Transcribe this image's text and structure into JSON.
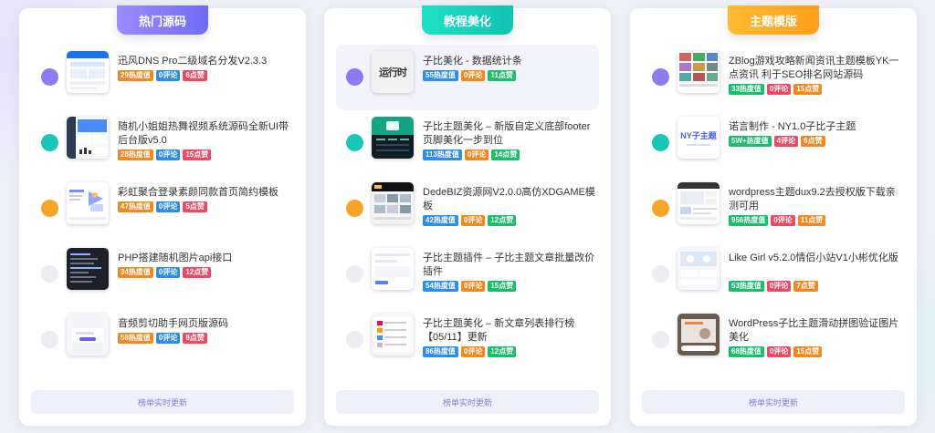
{
  "columns": [
    {
      "category": "热门源码",
      "category_colors": [
        "#9c8cff",
        "#6f6cf2"
      ],
      "footer": "榜单实时更新",
      "items": [
        {
          "title": "迅风DNS Pro二级域名分发V2.3.3",
          "hot": "29热度值",
          "comments": "0评论",
          "likes": "6点赞",
          "dot": "#8e7bf2",
          "thumb": "dns-panel",
          "highlight": false
        },
        {
          "title": "随机小姐姐热舞视频系统源码全新UI带后台版v5.0",
          "hot": "28热度值",
          "comments": "0评论",
          "likes": "15点赞",
          "dot": "#19c6b7",
          "thumb": "video-admin",
          "highlight": false
        },
        {
          "title": "彩虹聚合登录素颜同款首页简约模板",
          "hot": "47热度值",
          "comments": "0评论",
          "likes": "5点赞",
          "dot": "#f6a524",
          "thumb": "login-illustration",
          "highlight": false
        },
        {
          "title": "PHP搭建随机图片api接口",
          "hot": "34热度值",
          "comments": "0评论",
          "likes": "12点赞",
          "dot": "#ecedf3",
          "thumb": "code-dark",
          "highlight": false
        },
        {
          "title": "音频剪切助手网页版源码",
          "hot": "58热度值",
          "comments": "0评论",
          "likes": "8点赞",
          "dot": "#ecedf3",
          "thumb": "audio-tool",
          "highlight": false
        }
      ]
    },
    {
      "category": "教程美化",
      "category_colors": [
        "#1ee0c8",
        "#0fc3b0"
      ],
      "footer": "榜单实时更新",
      "items": [
        {
          "title": "子比美化 - 数据统计条",
          "hot": "55热度值",
          "comments": "0评论",
          "likes": "11点赞",
          "dot": "#8e7bf2",
          "thumb": "running-time",
          "thumb_text": "运行时",
          "highlight": true
        },
        {
          "title": "子比主题美化 – 新版自定义底部footer页脚美化一步到位",
          "hot": "113热度值",
          "comments": "0评论",
          "likes": "14点赞",
          "dot": "#19c6b7",
          "thumb": "footer-green",
          "highlight": false
        },
        {
          "title": "DedeBIZ资源网V2.0.0高仿XDGAME模板",
          "hot": "42热度值",
          "comments": "0评论",
          "likes": "12点赞",
          "dot": "#f6a524",
          "thumb": "game-site",
          "highlight": false
        },
        {
          "title": "子比主题插件 – 子比主题文章批量改价插件",
          "hot": "54热度值",
          "comments": "0评论",
          "likes": "15点赞",
          "dot": "#ecedf3",
          "thumb": "plugin-panel",
          "highlight": false
        },
        {
          "title": "子比主题美化 – 新文章列表排行榜【05/11】更新",
          "hot": "86热度值",
          "comments": "0评论",
          "likes": "12点赞",
          "dot": "#ecedf3",
          "thumb": "list-ranking",
          "highlight": false
        }
      ]
    },
    {
      "category": "主题模版",
      "category_colors": [
        "#ffbb33",
        "#ff9f1a"
      ],
      "footer": "榜单实时更新",
      "items": [
        {
          "title": "ZBlog游戏攻略新闻资讯主题模板YK一点资讯 利于SEO排名网站源码",
          "hot": "33热度值",
          "comments": "0评论",
          "likes": "15点赞",
          "dot": "#8e7bf2",
          "thumb": "game-grid",
          "highlight": false
        },
        {
          "title": "诺言制作 - NY1.0子比子主题",
          "hot": "5W+热度值",
          "comments": "4评论",
          "likes": "6点赞",
          "dot": "#19c6b7",
          "thumb": "ny-logo",
          "thumb_text": "NY子主题",
          "highlight": false
        },
        {
          "title": "wordpress主题dux9.2去授权版下载亲测可用",
          "hot": "956热度值",
          "comments": "0评论",
          "likes": "11点赞",
          "dot": "#f6a524",
          "thumb": "dux-site",
          "highlight": false
        },
        {
          "title": "Like Girl v5.2.0情侣小站V1小彬优化版",
          "hot": "53热度值",
          "comments": "0评论",
          "likes": "7点赞",
          "dot": "#ecedf3",
          "thumb": "love-site",
          "highlight": false
        },
        {
          "title": "WordPress子比主题滑动拼图验证图片美化",
          "hot": "68热度值",
          "comments": "0评论",
          "likes": "15点赞",
          "dot": "#ecedf3",
          "thumb": "puzzle-verify",
          "highlight": false
        }
      ]
    }
  ],
  "colors": {
    "hot": "#f5871f",
    "comments": "#2d8cf0",
    "likes": "#f04864"
  }
}
